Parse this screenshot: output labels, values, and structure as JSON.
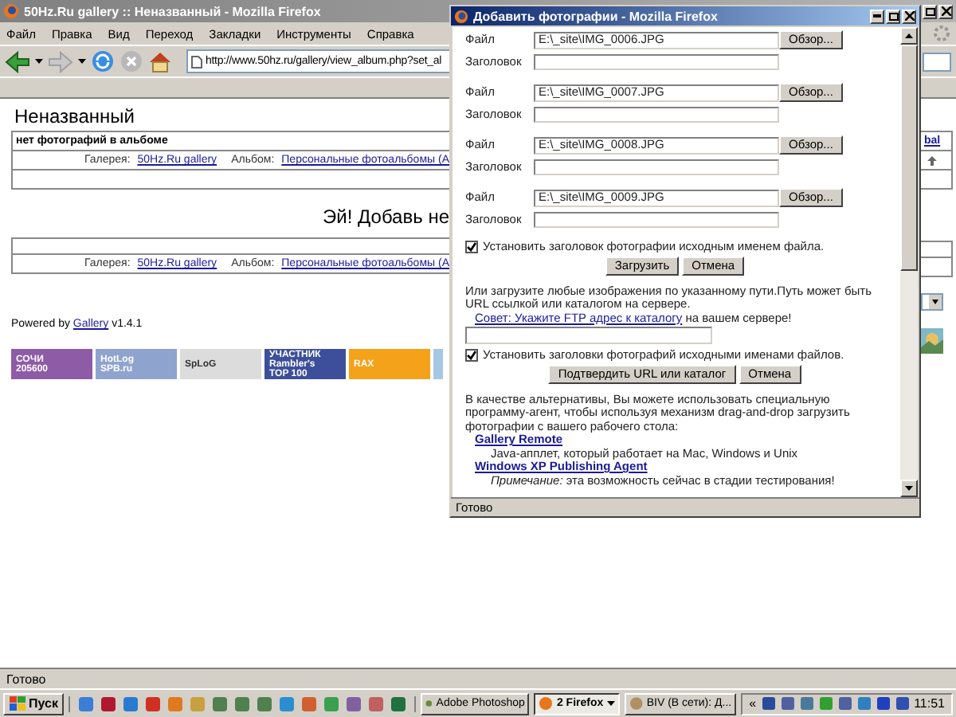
{
  "main_window": {
    "title": "50Hz.Ru gallery :: Неназванный - Mozilla Firefox"
  },
  "menu": [
    "Файл",
    "Правка",
    "Вид",
    "Переход",
    "Закладки",
    "Инструменты",
    "Справка"
  ],
  "address_bar": {
    "value": "http://www.50hz.ru/gallery/view_album.php?set_al"
  },
  "page": {
    "heading": "Неназванный",
    "notice": "нет фотографий в альбоме",
    "notice_link": "bal",
    "breadcrumbs": [
      {
        "gallery_label": "Галерея:",
        "gallery_link": "50Hz.Ru gallery",
        "album_label": "Альбом:",
        "album_link": "Персональные фотоальбомы (А"
      },
      {
        "gallery_label": "Галерея:",
        "gallery_link": "50Hz.Ru gallery",
        "album_label": "Альбом:",
        "album_link": "Персональные фотоальбомы (А"
      }
    ],
    "empty_message": "Эй! Добавь не",
    "powered": {
      "text": "Powered by",
      "link": "Gallery",
      "version": "v1.4.1"
    },
    "banners": [
      {
        "lines": [
          "СОЧИ",
          "205600"
        ],
        "color": "#8e5ba6"
      },
      {
        "lines": [
          "HotLog",
          "SPB.ru"
        ],
        "color": "#8fa3cf"
      },
      {
        "lines": [
          "SpLoG"
        ],
        "color": "#dcdcdc"
      },
      {
        "lines": [
          "УЧАСТНИК",
          "Rambler's",
          "TOP 100"
        ],
        "color": "#3d4f9a"
      },
      {
        "lines": [
          "RAX"
        ],
        "color": "#f4a21a"
      },
      {
        "color": "#a6c8e4"
      }
    ]
  },
  "status_bar": "Готово",
  "popup": {
    "title": "Добавить фотографии - Mozilla Firefox",
    "uploads": [
      {
        "file_label": "Файл",
        "file_value": "E:\\_site\\IMG_0006.JPG",
        "browse": "Обзор...",
        "caption_label": "Заголовок"
      },
      {
        "file_label": "Файл",
        "file_value": "E:\\_site\\IMG_0007.JPG",
        "browse": "Обзор...",
        "caption_label": "Заголовок"
      },
      {
        "file_label": "Файл",
        "file_value": "E:\\_site\\IMG_0008.JPG",
        "browse": "Обзор...",
        "caption_label": "Заголовок"
      },
      {
        "file_label": "Файл",
        "file_value": "E:\\_site\\IMG_0009.JPG",
        "browse": "Обзор...",
        "caption_label": "Заголовок"
      }
    ],
    "set_caption": {
      "label": "Установить заголовок фотографии исходным именем файла.",
      "checked": true
    },
    "buttons": [
      "Загрузить",
      "Отмена"
    ],
    "url_intro": "Или загрузите любые изображения по указанному пути.Путь может быть URL ссылкой или каталогом на сервере.",
    "url_tip_link": "Совет: Укажите FTP адрес к каталогу",
    "url_tip_rest": " на вашем сервере!",
    "set_captions": {
      "label": "Установить заголовки фотографий исходными именами файлов.",
      "checked": true
    },
    "url_buttons": [
      "Подтвердить URL или каталог",
      "Отмена"
    ],
    "alt_intro": "В качестве альтернативы, Вы можете использовать специальную программу-агент, чтобы используя механизм drag-and-drop загрузить фотографии с вашего рабочего стола:",
    "tools": [
      {
        "name": "Gallery Remote",
        "description": "Java-апплет, который работает на Mac, Windows и Unix"
      },
      {
        "name": "Windows XP Publishing Agent",
        "description": "*Примечание:* эта возможность сейчас в стадии тестирования!"
      }
    ],
    "status": "Готово"
  },
  "taskbar": {
    "start": "Пуск",
    "tasks": [
      {
        "label": "Adobe Photoshop",
        "selected": false,
        "grouped": false
      },
      {
        "label": "2 Firefox",
        "selected": true,
        "grouped": true
      },
      {
        "label": "BIV (В сети): Д...",
        "selected": false,
        "grouped": false
      }
    ],
    "tray_expand": "«",
    "clock": "11:51"
  }
}
